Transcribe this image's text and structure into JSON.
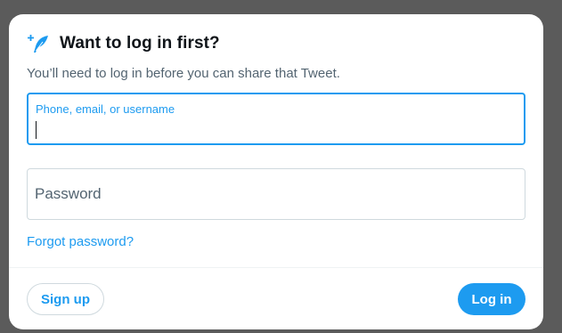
{
  "dialog": {
    "title": "Want to log in first?",
    "subtitle": "You’ll need to log in before you can share that Tweet.",
    "icon": "feather-plus-icon"
  },
  "username_field": {
    "label": "Phone, email, or username",
    "value": "",
    "focused": true
  },
  "password_field": {
    "placeholder": "Password",
    "value": ""
  },
  "forgot_password_label": "Forgot password?",
  "actions": {
    "signup_label": "Sign up",
    "login_label": "Log in"
  },
  "colors": {
    "accent": "#1d9bf0",
    "overlay": "#5b5b5b",
    "text_primary": "#0f1419",
    "text_secondary": "#536471",
    "border": "#cfd9de"
  }
}
